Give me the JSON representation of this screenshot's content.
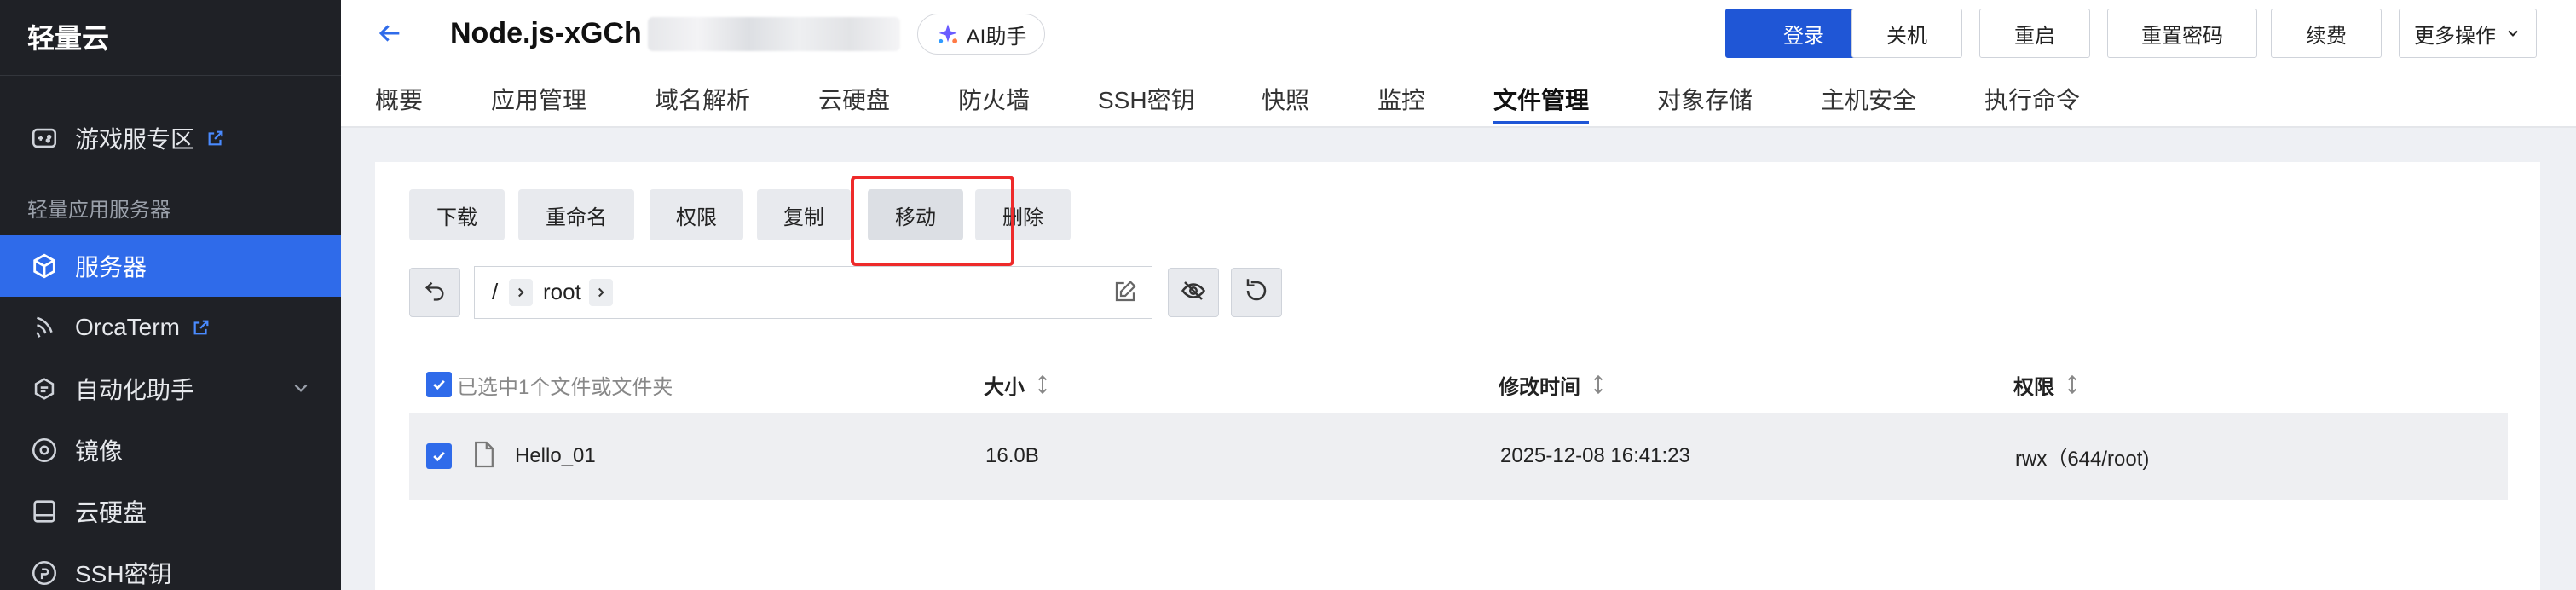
{
  "sidebar": {
    "brand": "轻量云",
    "section_label": "轻量应用服务器",
    "items": [
      {
        "label": "游戏服专区",
        "icon": "gamepad-icon",
        "external": true
      },
      {
        "label": "服务器",
        "icon": "server-cube-icon",
        "active": true
      },
      {
        "label": "OrcaTerm",
        "icon": "terminal-icon",
        "external": true
      },
      {
        "label": "自动化助手",
        "icon": "automation-icon",
        "expandable": true
      },
      {
        "label": "镜像",
        "icon": "image-disc-icon"
      },
      {
        "label": "云硬盘",
        "icon": "disk-icon"
      },
      {
        "label": "SSH密钥",
        "icon": "key-icon"
      }
    ]
  },
  "header": {
    "title": "Node.js-xGCh",
    "ai_label": "AI助手",
    "buttons": {
      "login": "登录",
      "shutdown": "关机",
      "restart": "重启",
      "reset_password": "重置密码",
      "renew": "续费",
      "more": "更多操作"
    },
    "tabs": [
      "概要",
      "应用管理",
      "域名解析",
      "云硬盘",
      "防火墙",
      "SSH密钥",
      "快照",
      "监控",
      "文件管理",
      "对象存储",
      "主机安全",
      "执行命令"
    ],
    "active_tab": "文件管理"
  },
  "toolbar": {
    "download": "下载",
    "rename": "重命名",
    "permissions": "权限",
    "copy": "复制",
    "move": "移动",
    "delete": "删除"
  },
  "path": {
    "root": "/",
    "folder": "root"
  },
  "table": {
    "selection_text": "已选中1个文件或文件夹",
    "columns": [
      "大小",
      "修改时间",
      "权限"
    ],
    "rows": [
      {
        "name": "Hello_01",
        "size": "16.0B",
        "modified": "2025-12-08 16:41:23",
        "permission": "rwx（644/root)",
        "checked": true
      }
    ]
  },
  "colors": {
    "accent": "#2f6bea",
    "primary_button": "#1f56d6",
    "sidebar_bg": "#1f2126",
    "highlight": "#ee2a2a"
  }
}
